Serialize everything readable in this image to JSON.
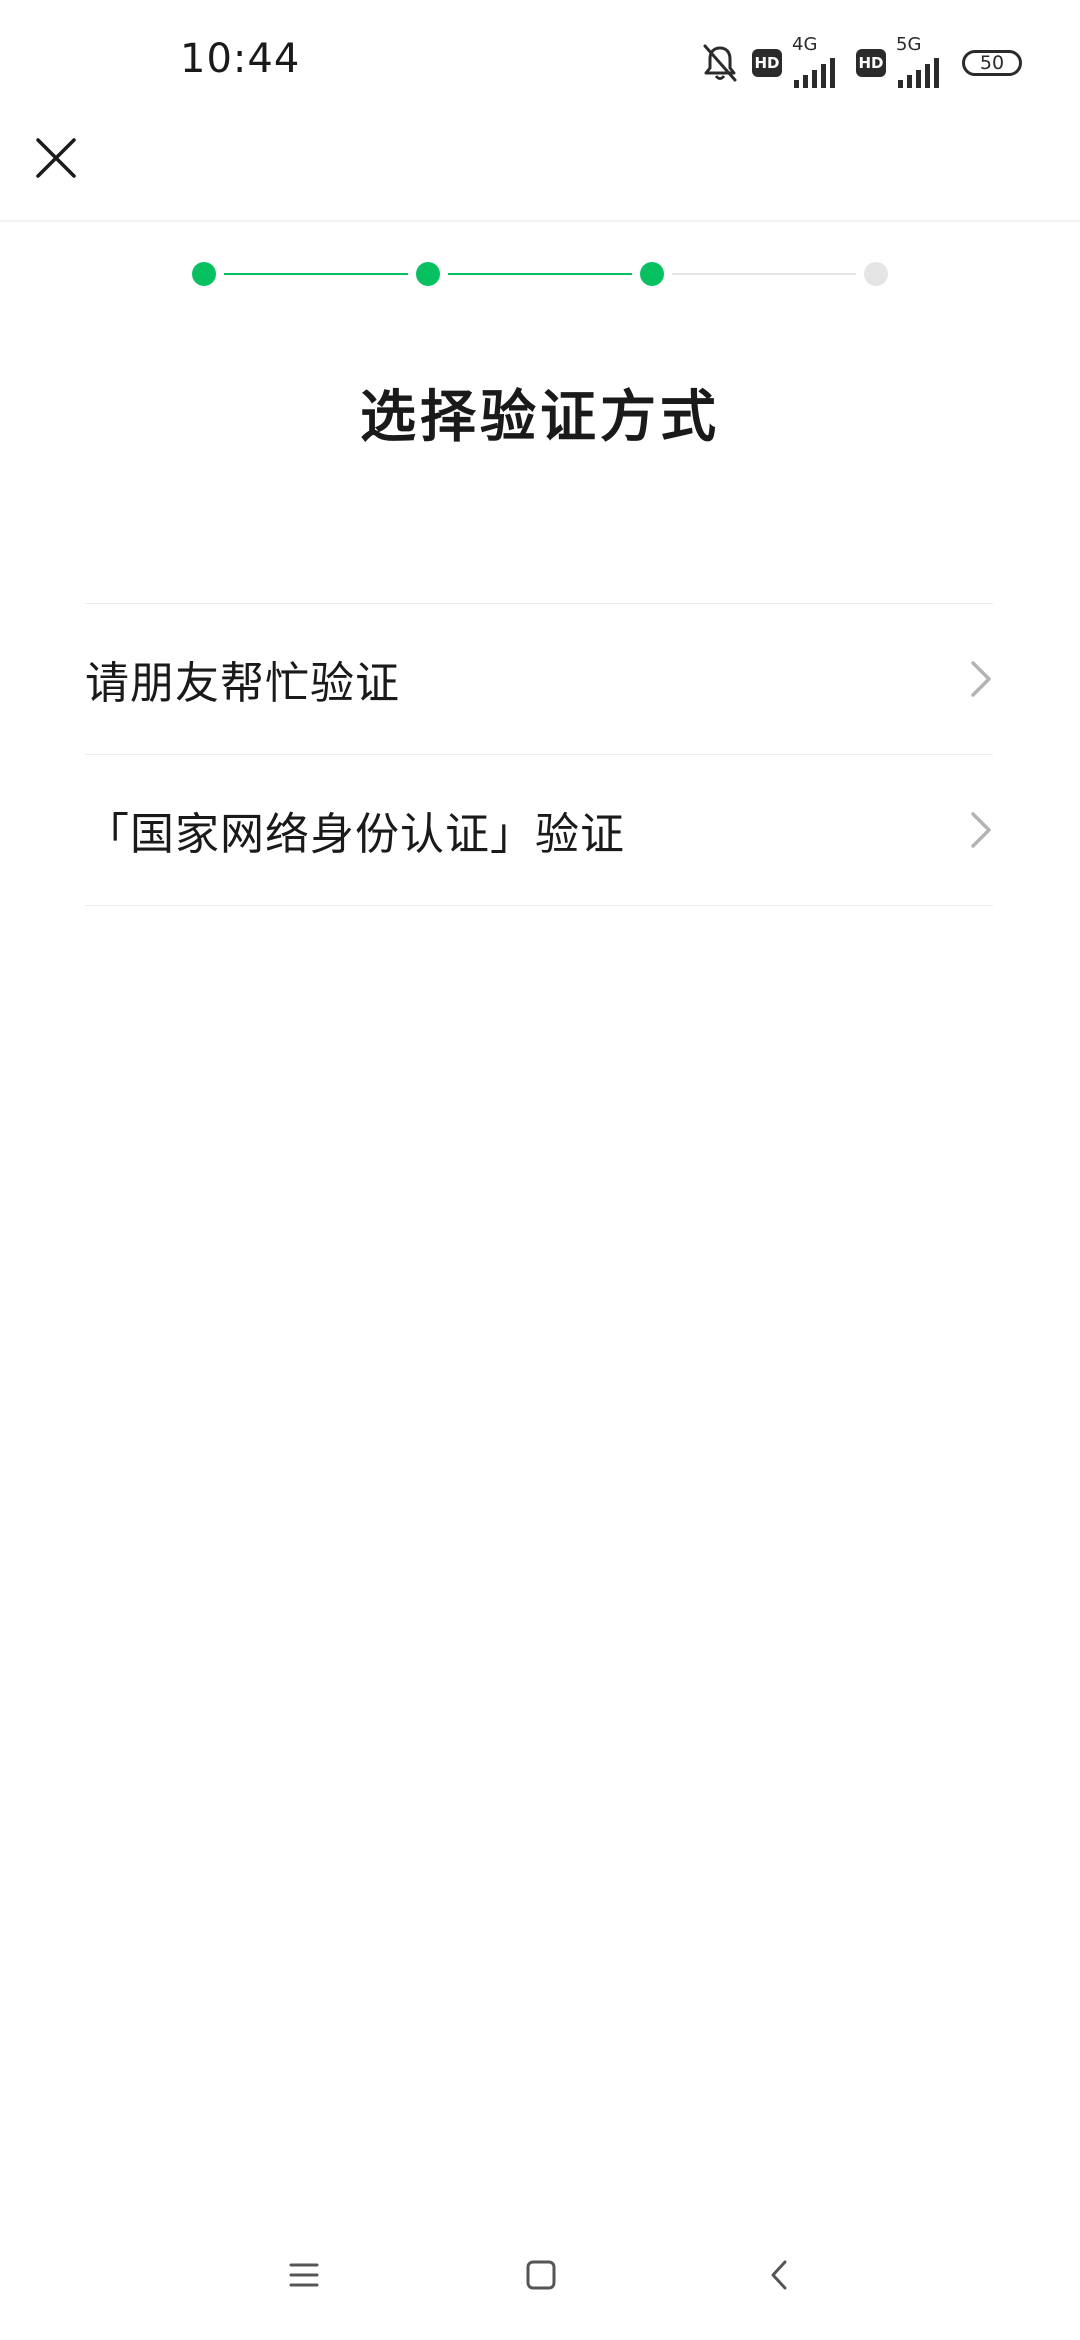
{
  "status_bar": {
    "time": "10:44",
    "network_1": "4G",
    "network_2": "5G",
    "hd_label": "HD",
    "battery": "50",
    "icons": [
      "bell-muted-icon",
      "hd-icon",
      "signal-icon",
      "hd-icon",
      "signal-icon",
      "battery-icon"
    ]
  },
  "header": {
    "close_icon": "close-icon"
  },
  "stepper": {
    "total_steps": 4,
    "completed_steps": 3,
    "active_color": "#07c160",
    "inactive_color": "#e5e5e5"
  },
  "page": {
    "title": "选择验证方式"
  },
  "options": [
    {
      "label": "请朋友帮忙验证",
      "icon": "chevron-right-icon"
    },
    {
      "label": "「国家网络身份认证」验证",
      "icon": "chevron-right-icon"
    }
  ],
  "nav_bar": {
    "icons": [
      "menu-icon",
      "home-icon",
      "back-icon"
    ]
  }
}
